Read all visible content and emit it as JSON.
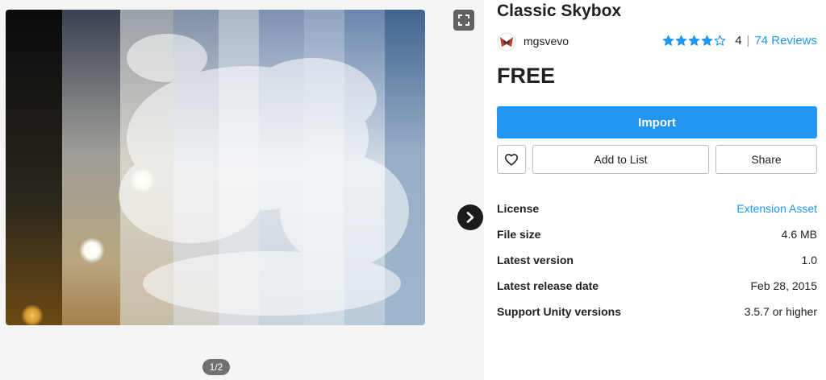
{
  "asset": {
    "title": "Classic Skybox",
    "publisher": "mgsvevo",
    "rating": 4,
    "rating_value": "4",
    "reviews_label": "74 Reviews",
    "price": "FREE"
  },
  "gallery": {
    "pager": "1/2",
    "current_index": 1,
    "total_images": 2
  },
  "actions": {
    "import_label": "Import",
    "add_to_list_label": "Add to List",
    "share_label": "Share"
  },
  "info": [
    {
      "label": "License",
      "value": "Extension Asset",
      "is_link": true
    },
    {
      "label": "File size",
      "value": "4.6 MB"
    },
    {
      "label": "Latest version",
      "value": "1.0"
    },
    {
      "label": "Latest release date",
      "value": "Feb 28, 2015"
    },
    {
      "label": "Support Unity versions",
      "value": "3.5.7 or higher"
    }
  ],
  "colors": {
    "accent": "#2196f3",
    "text": "#212121",
    "gallery_bg": "#f5f5f5",
    "star": "#2196f3"
  },
  "icons": {
    "expand": "expand-icon",
    "next": "chevron-right-icon",
    "favorite": "heart-outline-icon",
    "star": "star-icon",
    "avatar": "publisher-logo"
  }
}
